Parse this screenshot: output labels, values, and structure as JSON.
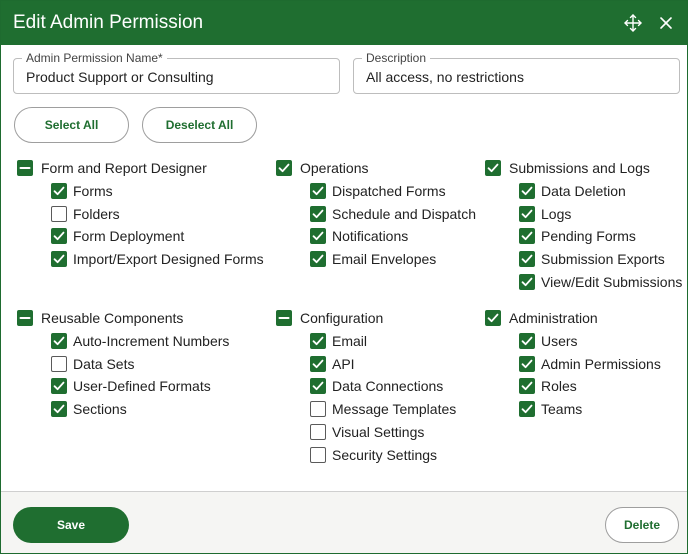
{
  "dialog": {
    "title": "Edit Admin Permission",
    "move_icon": "move-icon",
    "close_icon": "close-icon",
    "accent_color": "#1f6e30"
  },
  "fields": {
    "name": {
      "label": "Admin Permission Name*",
      "value": "Product Support or Consulting"
    },
    "description": {
      "label": "Description",
      "value": "All access, no restrictions"
    }
  },
  "buttons": {
    "select_all": "Select All",
    "deselect_all": "Deselect All",
    "save": "Save",
    "delete": "Delete"
  },
  "groups": [
    {
      "label": "Form and Report Designer",
      "state": "partial",
      "items": [
        {
          "label": "Forms",
          "checked": true
        },
        {
          "label": "Folders",
          "checked": false
        },
        {
          "label": "Form Deployment",
          "checked": true
        },
        {
          "label": "Import/Export Designed Forms",
          "checked": true
        }
      ]
    },
    {
      "label": "Operations",
      "state": "checked",
      "items": [
        {
          "label": "Dispatched Forms",
          "checked": true
        },
        {
          "label": "Schedule and Dispatch",
          "checked": true
        },
        {
          "label": "Notifications",
          "checked": true
        },
        {
          "label": "Email Envelopes",
          "checked": true
        }
      ]
    },
    {
      "label": "Submissions and Logs",
      "state": "checked",
      "items": [
        {
          "label": "Data Deletion",
          "checked": true
        },
        {
          "label": "Logs",
          "checked": true
        },
        {
          "label": "Pending Forms",
          "checked": true
        },
        {
          "label": "Submission Exports",
          "checked": true
        },
        {
          "label": "View/Edit Submissions",
          "checked": true
        }
      ]
    },
    {
      "label": "Reusable Components",
      "state": "partial",
      "items": [
        {
          "label": "Auto-Increment Numbers",
          "checked": true
        },
        {
          "label": "Data Sets",
          "checked": false
        },
        {
          "label": "User-Defined Formats",
          "checked": true
        },
        {
          "label": "Sections",
          "checked": true
        }
      ]
    },
    {
      "label": "Configuration",
      "state": "partial",
      "items": [
        {
          "label": "Email",
          "checked": true
        },
        {
          "label": "API",
          "checked": true
        },
        {
          "label": "Data Connections",
          "checked": true
        },
        {
          "label": "Message Templates",
          "checked": false
        },
        {
          "label": "Visual Settings",
          "checked": false
        },
        {
          "label": "Security Settings",
          "checked": false
        }
      ]
    },
    {
      "label": "Administration",
      "state": "checked",
      "items": [
        {
          "label": "Users",
          "checked": true
        },
        {
          "label": "Admin Permissions",
          "checked": true
        },
        {
          "label": "Roles",
          "checked": true
        },
        {
          "label": "Teams",
          "checked": true
        }
      ]
    }
  ]
}
